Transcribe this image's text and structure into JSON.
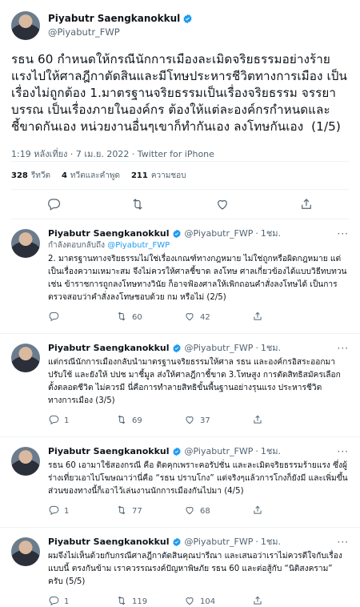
{
  "main": {
    "name": "Piyabutr Saengkanokkul",
    "handle": "@Piyabutr_FWP",
    "text": "รธน 60 กำหนดให้กรณีนักการเมืองละเมิดจริยธรรมอย่างร้ายแรงไปให้ศาลฎีกาตัดสินและมีโทษประหารชีวิตทางการเมือง เป็นเรื่องไม่ถูกต้อง 1.มาตรฐานจริยธรรมเป็นเรื่องจริยธรรม จรรยาบรรณ เป็นเรื่องภายในองค์กร ต้องให้แต่ละองค์กรกำหนดและชี้ขาดกันเอง หน่วยงานอื่นๆเขาก็ทำกันเอง ลงโทษกันเอง  (1/5)",
    "meta": "1:19 หลังเที่ยง · 7 เม.ย. 2022 · Twitter for iPhone",
    "stats": {
      "retweets_num": "328",
      "retweets_label": "รีทวีต",
      "quotes_num": "4",
      "quotes_label": "ทวีตและคำพูด",
      "likes_num": "211",
      "likes_label": "ความชอบ"
    }
  },
  "replies": [
    {
      "name": "Piyabutr Saengkanokkul",
      "handle": "@Piyabutr_FWP",
      "time": "1ชม.",
      "replying_prefix": "กำลังตอบกลับถึง",
      "replying_to": "@Piyabutr_FWP",
      "text": "2. มาตรฐานทางจริยธรรมไม่ใช่เรื่องเกณฑ์ทางกฎหมาย ไม่ใช่ถูกหรือผิดกฎหมาย แต่เป็นเรื่องความเหมาะสม จึงไม่ควรให้ศาลชี้ขาด ลงโทษ ศาลเกี่ยวข้องได้แบบวิธีทบทวน เช่น ข้าราชการถูกลงโทษทางวินัย ก็อาจฟ้องศาลให้เพิกถอนคำสั่งลงโทษได้ เป็นการตรวจสอบว่าคำสั่งลงโทษชอบด้วย กม หรือไม่ (2/5)",
      "replies": "",
      "retweets": "60",
      "likes": "42"
    },
    {
      "name": "Piyabutr Saengkanokkul",
      "handle": "@Piyabutr_FWP",
      "time": "1ชม.",
      "replying_prefix": "",
      "replying_to": "",
      "text": "แต่กรณีนักการเมืองกลับนำมาตรฐานจริยธรรมให้ศาล รธน และองค์กรอิสระออกมาปรับใช้ และยังให้ ปปช มาชี้มูล ส่งให้ศาลฎีกาชี้ขาด 3.โทษสูง การตัดสิทธิสมัครเลือกตั้งตลอดชีวิต ไม่ควรมี นี่คือการทำลายสิทธิขั้นพื้นฐานอย่างรุนแรง ประหารชีวิตทางการเมือง (3/5)",
      "replies": "1",
      "retweets": "69",
      "likes": "37"
    },
    {
      "name": "Piyabutr Saengkanokkul",
      "handle": "@Piyabutr_FWP",
      "time": "1ชม.",
      "replying_prefix": "",
      "replying_to": "",
      "text": "รธน 60 เอามาใช้สองกรณี คือ ติดคุกเพราะคอรัปชั่น และละเมิดจริยธรรมร้ายแรง ซึ่งผู้ร่างเที่ยวเอาไปโฆษณาว่านี่คือ “รธน ปราบโกง” แต่จริงๆแล้วการโกงก็ยังมี และเพิ่มขึ้น ส่วนของทางนี้ก็เอาไว้เล่นงานนักการเมืองกันไปมา (4/5)",
      "replies": "1",
      "retweets": "77",
      "likes": "68"
    },
    {
      "name": "Piyabutr Saengkanokkul",
      "handle": "@Piyabutr_FWP",
      "time": "1ชม.",
      "replying_prefix": "",
      "replying_to": "",
      "text": "ผมจึงไม่เห็นด้วยกับกรณีศาลฎีกาตัดสินคุณปารีณา และเสนอว่าเราไม่ควรตีใจกับเรื่องแบบนี้ ตรงกันข้าม เราควรรณรงค์ปัญหาพิษภัย รธน 60 และต่อสู้กับ “นิติสงคราม” ครับ (5/5)",
      "replies": "1",
      "retweets": "119",
      "likes": "104"
    }
  ],
  "colors": {
    "accent": "#1d9bf0",
    "muted": "#536471",
    "text": "#0f1419"
  }
}
